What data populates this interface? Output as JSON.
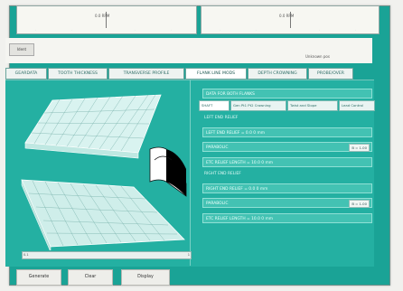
{
  "gauges": [
    {
      "label": "0.0 RPM"
    },
    {
      "label": "0.0 RPM"
    }
  ],
  "toolbar": {
    "small_button_label": "Ident",
    "right_label": "Unknown pos"
  },
  "tabs": [
    {
      "label": "GEARDATA"
    },
    {
      "label": "TOOTH THICKNESS"
    },
    {
      "label": "TRANSVERSE PROFILE"
    },
    {
      "label": "FLANK LINE MODS"
    },
    {
      "label": "DEPTH CROWNING"
    },
    {
      "label": "PROBE/OVER"
    }
  ],
  "right_panel": {
    "header": "DATA FOR BOTH FLANKS",
    "subtabs": [
      {
        "label": "SHAFT"
      },
      {
        "label": "Gen Pt1 Pt2 Crowning"
      },
      {
        "label": "Twist and Slope"
      },
      {
        "label": "Lead Control"
      }
    ],
    "left_relief_heading": "LEFT END RELIEF",
    "left_end_relief": "LEFT END RELIEF = 0.0 0 mm",
    "left_parabolic": "PARABOLIC",
    "left_parabolic_value": "B = 1.00",
    "left_length": "ETC RELIEF LENGTH = 10.0 0 mm",
    "right_relief_heading": "RIGHT END RELIEF",
    "right_end_relief": "RIGHT END RELIEF = 0.0 0 mm",
    "right_parabolic": "PARABOLIC",
    "right_parabolic_value": "B = 1.00",
    "right_length": "ETC RELIEF LENGTH = 10.0 0 mm"
  },
  "graphic": {
    "left_scale": "0.1",
    "right_scale": "1"
  },
  "buttons": {
    "generate": "Generate",
    "clear": "Clear",
    "display": "Display"
  }
}
